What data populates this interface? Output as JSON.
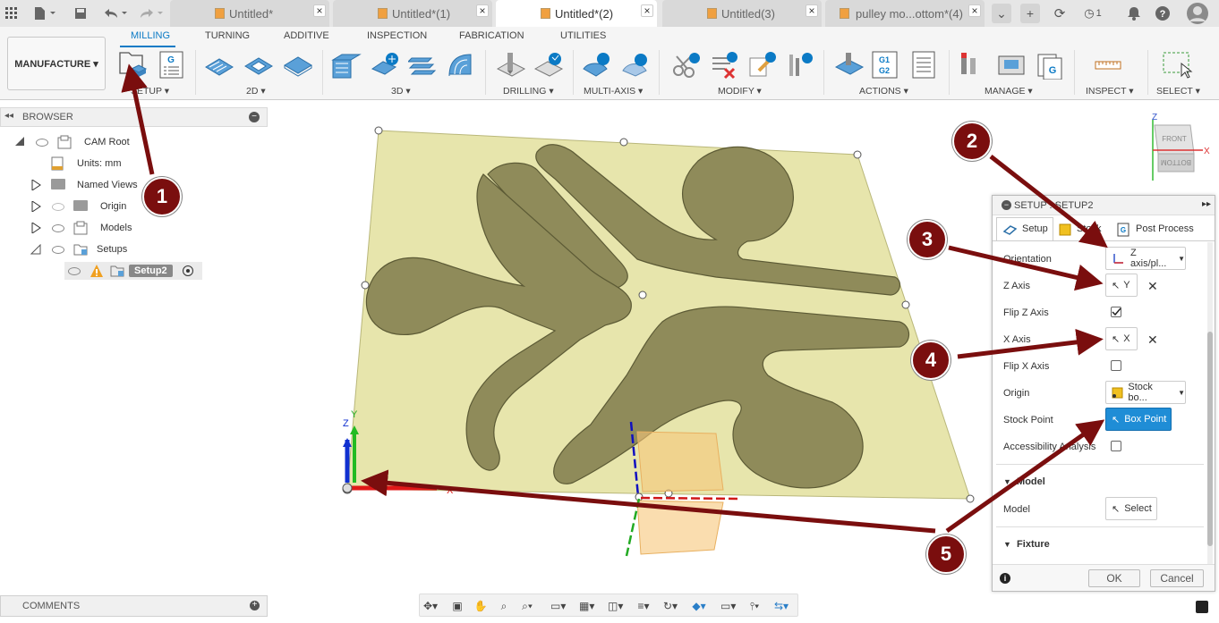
{
  "quick_access": {
    "grid_icon": "grid-icon",
    "file_icon": "file-icon",
    "save_icon": "save-icon",
    "undo_icon": "undo-icon",
    "redo_icon": "redo-icon"
  },
  "doc_tabs": [
    {
      "label": "Untitled*",
      "active": false
    },
    {
      "label": "Untitled*(1)",
      "active": false
    },
    {
      "label": "Untitled*(2)",
      "active": true
    },
    {
      "label": "Untitled(3)",
      "active": false
    },
    {
      "label": "pulley mo...ottom*(4)",
      "active": false
    }
  ],
  "tab_close": "×",
  "titlebar_right": {
    "clock_count": "1"
  },
  "workspace": {
    "label": "MANUFACTURE ▾"
  },
  "ribbon_tabs": [
    "MILLING",
    "TURNING",
    "ADDITIVE",
    "INSPECTION",
    "FABRICATION",
    "UTILITIES"
  ],
  "ribbon_groups": [
    "SETUP ▾",
    "2D ▾",
    "3D ▾",
    "DRILLING ▾",
    "MULTI-AXIS ▾",
    "MODIFY ▾",
    "ACTIONS ▾",
    "MANAGE ▾",
    "INSPECT ▾",
    "SELECT ▾"
  ],
  "ribbon_icon_labels": {
    "g_label": "G",
    "g1g2_label": "G1\nG2",
    "g_manage": "G"
  },
  "browser": {
    "title": "BROWSER",
    "items": [
      {
        "label": "CAM Root"
      },
      {
        "label": "Units: mm"
      },
      {
        "label": "Named Views"
      },
      {
        "label": "Origin"
      },
      {
        "label": "Models"
      },
      {
        "label": "Setups"
      },
      {
        "label": "Setup2"
      }
    ]
  },
  "viewcube": {
    "front": "FRONT",
    "bottom": "BOTTOM",
    "z": "Z",
    "x": "X"
  },
  "triad": {
    "z": "Z",
    "y": "Y",
    "x": "X"
  },
  "setup_panel": {
    "title": "SETUP : SETUP2",
    "tabs": [
      "Setup",
      "Stock",
      "Post Process"
    ],
    "rows": {
      "orientation": "Orientation",
      "orientation_value": "Z axis/pl...",
      "z_axis": "Z Axis",
      "z_axis_value": "Y",
      "flip_z": "Flip Z Axis",
      "flip_z_checked": true,
      "x_axis": "X Axis",
      "x_axis_value": "X",
      "flip_x": "Flip X Axis",
      "flip_x_checked": false,
      "origin": "Origin",
      "origin_value": "Stock bo...",
      "stock_point": "Stock Point",
      "stock_point_value": "Box Point",
      "accessibility": "Accessibility Analysis",
      "accessibility_checked": false
    },
    "model_section": "Model",
    "model_label": "Model",
    "model_value": "Select",
    "fixture_section": "Fixture",
    "ok": "OK",
    "cancel": "Cancel"
  },
  "comments": {
    "label": "COMMENTS"
  },
  "callouts": [
    "1",
    "2",
    "3",
    "4",
    "5"
  ],
  "colors": {
    "accent": "#0b7ac5",
    "callout": "#7a0e0e",
    "stock": "#e6e4a8",
    "part": "#8f8b5a"
  }
}
